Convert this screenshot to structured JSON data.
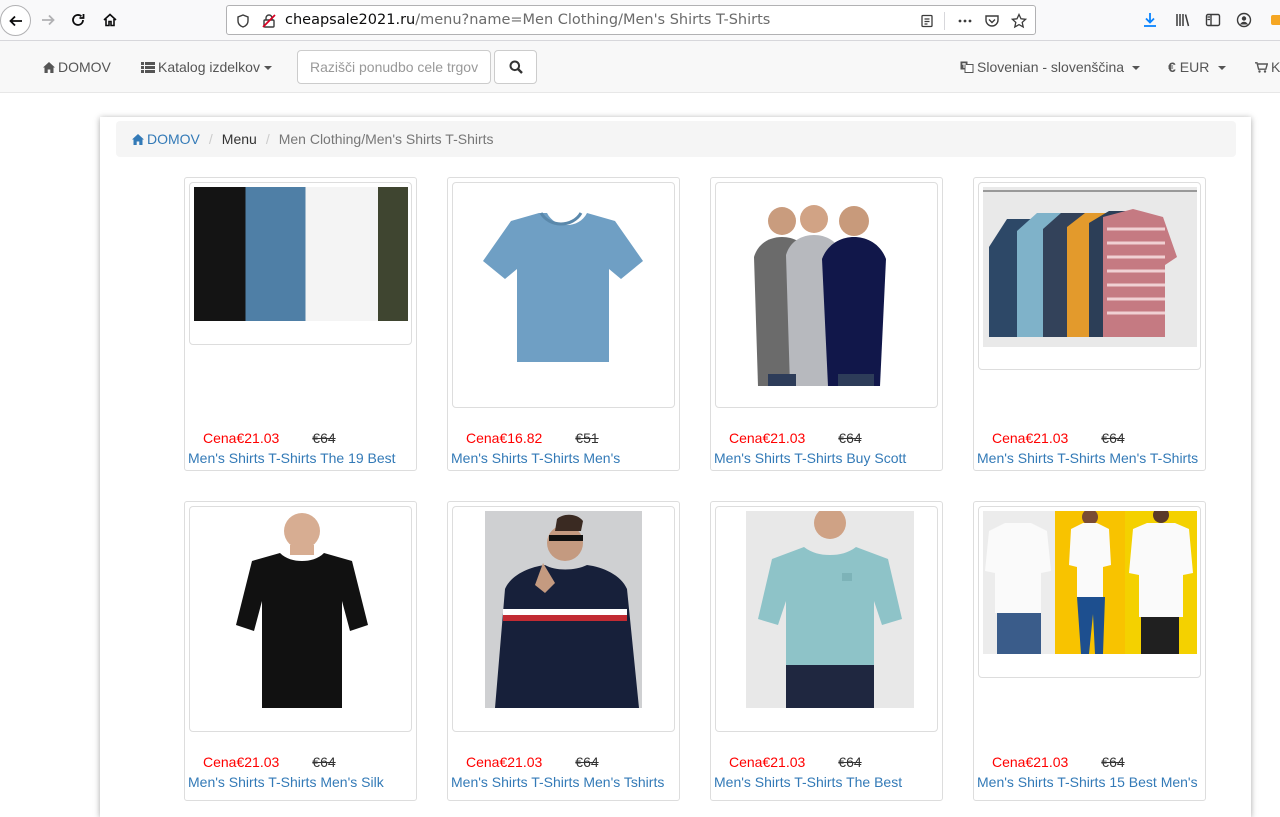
{
  "browser": {
    "url_host": "cheapsale2021.ru",
    "url_path": "/menu?name=Men Clothing/Men's Shirts T-Shirts"
  },
  "nav": {
    "home": "DOMOV",
    "catalog": "Katalog izdelkov",
    "search_placeholder": "Razišči ponudbo cele trgovine",
    "language": "Slovenian - slovenščina",
    "currency": "EUR",
    "cart": "K"
  },
  "breadcrumb": {
    "home": "DOMOV",
    "menu": "Menu",
    "current": "Men Clothing/Men's Shirts T-Shirts"
  },
  "products": [
    {
      "price": "Cena€21.03",
      "old_price": "€64",
      "title": "Men's Shirts T-Shirts The 19 Best"
    },
    {
      "price": "Cena€16.82",
      "old_price": "€51",
      "title": "Men's Shirts T-Shirts Men's"
    },
    {
      "price": "Cena€21.03",
      "old_price": "€64",
      "title": "Men's Shirts T-Shirts Buy Scott"
    },
    {
      "price": "Cena€21.03",
      "old_price": "€64",
      "title": "Men's Shirts T-Shirts Men's T-Shirts"
    },
    {
      "price": "Cena€21.03",
      "old_price": "€64",
      "title": "Men's Shirts T-Shirts Men's Silk"
    },
    {
      "price": "Cena€21.03",
      "old_price": "€64",
      "title": "Men's Shirts T-Shirts Men's Tshirts"
    },
    {
      "price": "Cena€21.03",
      "old_price": "€64",
      "title": "Men's Shirts T-Shirts The Best"
    },
    {
      "price": "Cena€21.03",
      "old_price": "€64",
      "title": "Men's Shirts T-Shirts 15 Best Men's"
    }
  ]
}
